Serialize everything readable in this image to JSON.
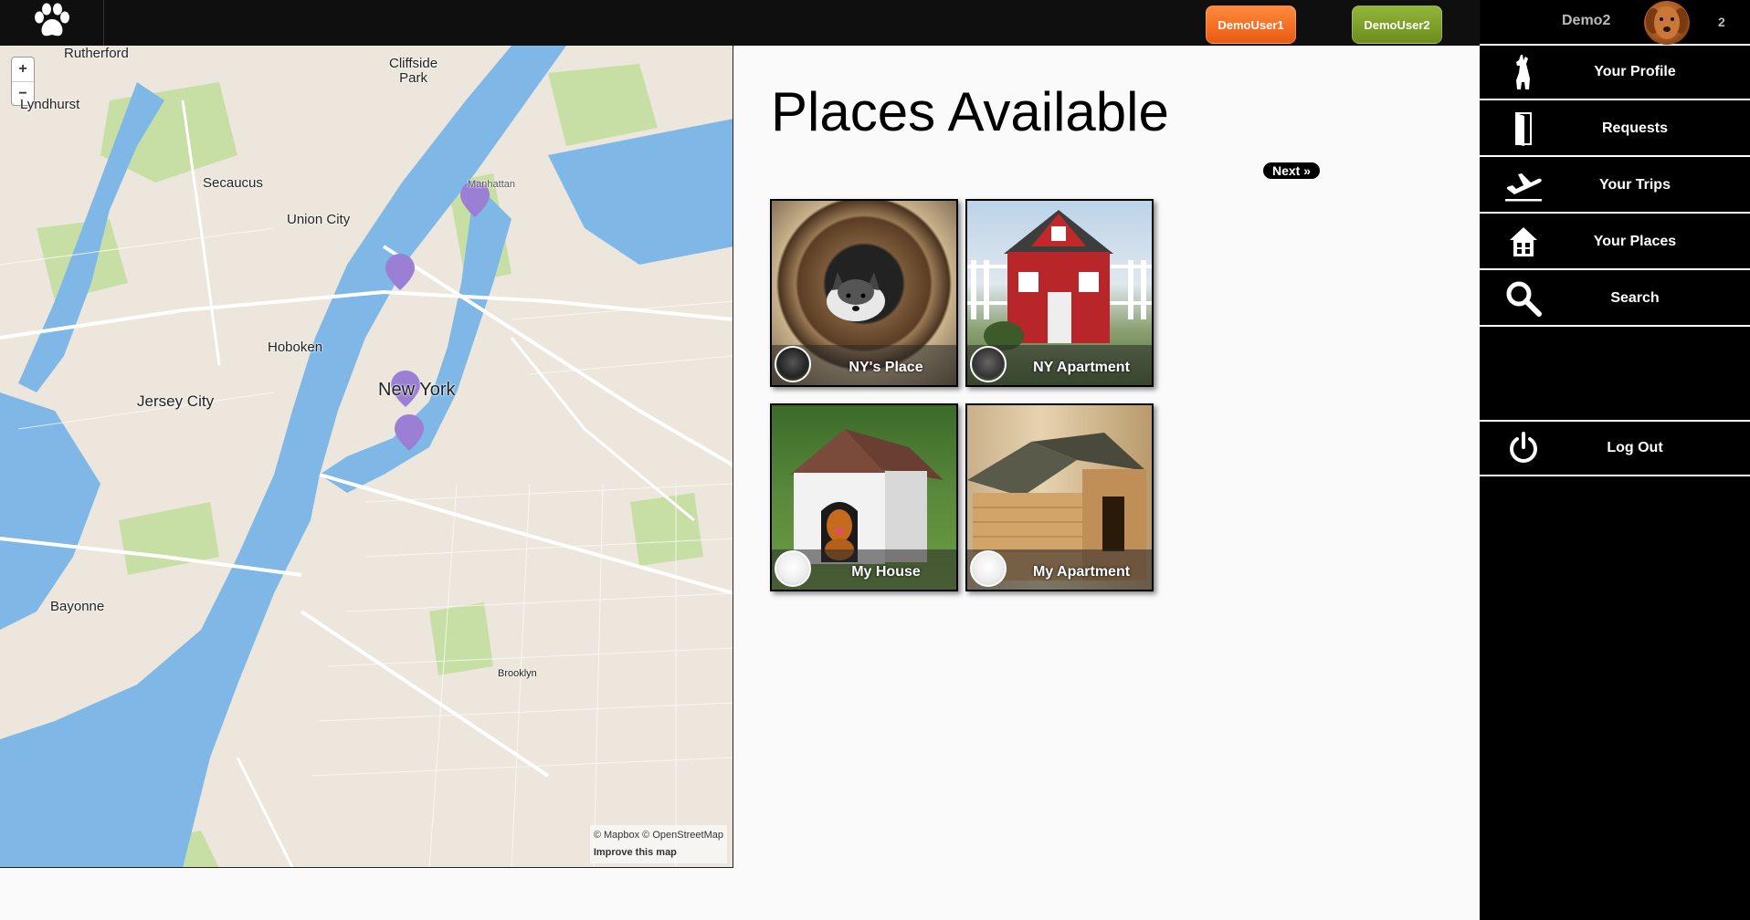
{
  "topbar": {
    "logo_icon": "paw-icon",
    "users": [
      {
        "label": "DemoUser1",
        "color": "#f26a21"
      },
      {
        "label": "DemoUser2",
        "color": "#7a9a24"
      }
    ]
  },
  "sidebar": {
    "username": "Demo2",
    "count": "2",
    "items": [
      {
        "label": "Your Profile",
        "icon": "dog-icon"
      },
      {
        "label": "Requests",
        "icon": "door-icon"
      },
      {
        "label": "Your Trips",
        "icon": "airplane-icon"
      },
      {
        "label": "Your Places",
        "icon": "house-icon"
      },
      {
        "label": "Search",
        "icon": "search-icon"
      },
      {
        "label": "Log Out",
        "icon": "power-icon"
      }
    ]
  },
  "map": {
    "zoom_in": "+",
    "zoom_out": "−",
    "labels": {
      "rutherford": "Rutherford",
      "cliffside": "Cliffside\nPark",
      "lyndhurst": "Lyndhurst",
      "secaucus": "Secaucus",
      "union_city": "Union City",
      "hoboken": "Hoboken",
      "jersey_city": "Jersey City",
      "new_york": "New York",
      "bayonne": "Bayonne",
      "brooklyn": "Brooklyn",
      "manhattan": "Manhattan"
    },
    "attribution_line1": "© Mapbox © OpenStreetMap",
    "attribution_line2": "Improve this map",
    "pin_color": "#9b7fd4"
  },
  "main": {
    "title": "Places Available",
    "next_label": "Next »",
    "places": [
      {
        "name": "NY's Place"
      },
      {
        "name": "NY Apartment"
      },
      {
        "name": "My House"
      },
      {
        "name": "My Apartment"
      }
    ]
  }
}
